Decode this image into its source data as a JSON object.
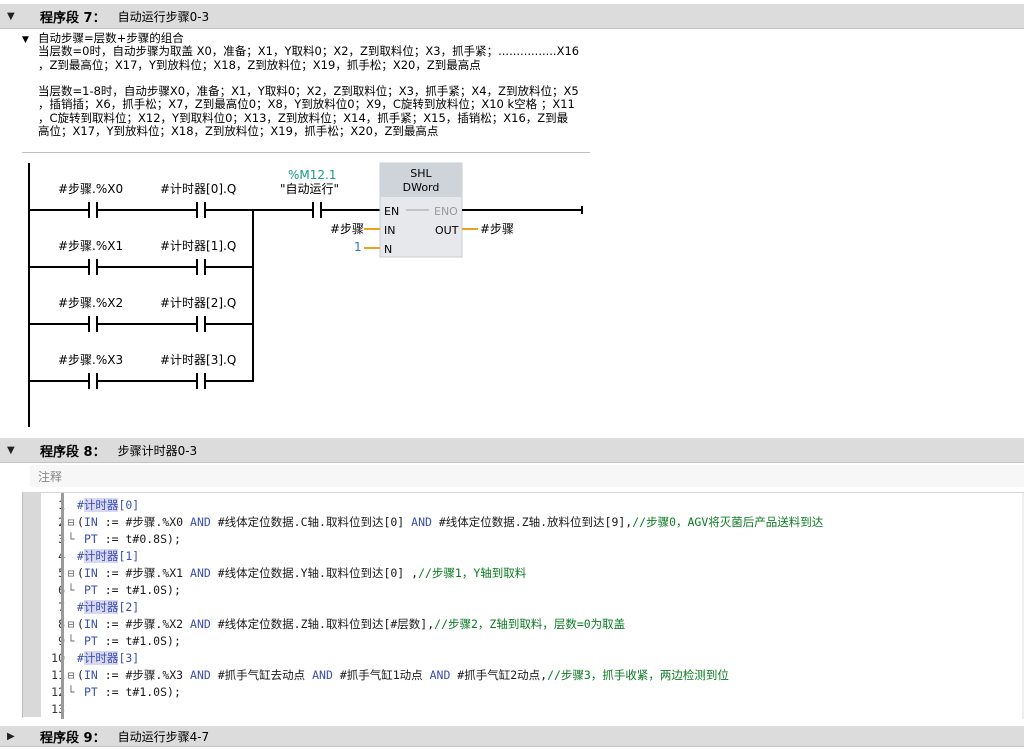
{
  "segment7": {
    "title": "程序段 7：",
    "desc": "自动运行步骤0-3",
    "comment": "自动步骤=层数+步骤的组合\n当层数=0时，自动步骤为取盖 X0，准备；X1，Y取料0；X2，Z到取料位；X3，抓手紧；................X16\n，Z到最高位；X17，Y到放料位；X18，Z到放料位；X19，抓手松；X20，Z到最高点\n\n当层数=1-8时，自动步骤X0，准备；X1，Y取料0；X2，Z到取料位；X3，抓手紧；X4，Z到放料位；X5\n，插销插；X6，抓手松；X7，Z到最高位0；X8，Y到放料位0；X9，C旋转到放料位；X10 k空格 ；X11\n，C旋转到取料位；X12，Y到取料位0；X13，Z到放料位；X14，抓手紧；X15，插销松；X16，Z到最\n高位；X17，Y到放料位；X18，Z到放料位；X19，抓手松；X20，Z到最高点",
    "rungs": [
      {
        "contact1": "#步骤.%X0",
        "contact2": "#计时器[0].Q"
      },
      {
        "contact1": "#步骤.%X1",
        "contact2": "#计时器[1].Q"
      },
      {
        "contact1": "#步骤.%X2",
        "contact2": "#计时器[2].Q"
      },
      {
        "contact1": "#步骤.%X3",
        "contact2": "#计时器[3].Q"
      }
    ],
    "auto_contact": {
      "address": "%M12.1",
      "name": "\"自动运行\""
    },
    "shl_block": {
      "name": "SHL",
      "type": "DWord",
      "en": "EN",
      "eno": "ENO",
      "in": "IN",
      "out": "OUT",
      "n": "N",
      "in_operand": "#步骤",
      "out_operand": "#步骤",
      "n_operand": "1"
    }
  },
  "segment8": {
    "title": "程序段 8：",
    "desc": "步骤计时器0-3",
    "comment_placeholder": "注释",
    "code": [
      {
        "n": "1",
        "fold": "",
        "text": "#计时器[0]",
        "kind": "hl"
      },
      {
        "n": "2",
        "fold": "⊟",
        "text": "(IN := #步骤.%X0 AND #线体定位数据.C轴.取料位到达[0] AND #线体定位数据.Z轴.放料位到达[9],",
        "comment": "//步骤0，AGV将灭菌后产品送料到达"
      },
      {
        "n": "3",
        "fold": "└",
        "text": " PT := t#0.8S);"
      },
      {
        "n": "4",
        "fold": "",
        "text": "#计时器[1]",
        "kind": "hl"
      },
      {
        "n": "5",
        "fold": "⊟",
        "text": "(IN := #步骤.%X1 AND #线体定位数据.Y轴.取料位到达[0] ,",
        "comment": "//步骤1，Y轴到取料"
      },
      {
        "n": "6",
        "fold": "└",
        "text": " PT := t#1.0S);"
      },
      {
        "n": "7",
        "fold": "",
        "text": "#计时器[2]",
        "kind": "hl"
      },
      {
        "n": "8",
        "fold": "⊟",
        "text": "(IN := #步骤.%X2 AND #线体定位数据.Z轴.取料位到达[#层数],",
        "comment": "//步骤2，Z轴到取料，层数=0为取盖"
      },
      {
        "n": "9",
        "fold": "└",
        "text": " PT := t#1.0S);"
      },
      {
        "n": "10",
        "fold": "",
        "text": "#计时器[3]",
        "kind": "hl"
      },
      {
        "n": "11",
        "fold": "⊟",
        "text": "(IN := #步骤.%X3 AND #抓手气缸去动点 AND #抓手气缸1动点 AND #抓手气缸2动点,",
        "comment": "//步骤3，抓手收紧，两边检测到位"
      },
      {
        "n": "12",
        "fold": "└",
        "text": " PT := t#1.0S);"
      },
      {
        "n": "13",
        "fold": "",
        "text": ""
      }
    ]
  },
  "segment9": {
    "title": "程序段 9：",
    "desc": "自动运行步骤4-7"
  },
  "colors": {
    "header_bg": "#dcdcdc",
    "operand_teal": "#1a9a8a",
    "wire_orange": "#f0a020",
    "block_bg": "#dde0e6",
    "comment_green": "#0c7a23",
    "keyword_blue": "#3a4fb0"
  }
}
